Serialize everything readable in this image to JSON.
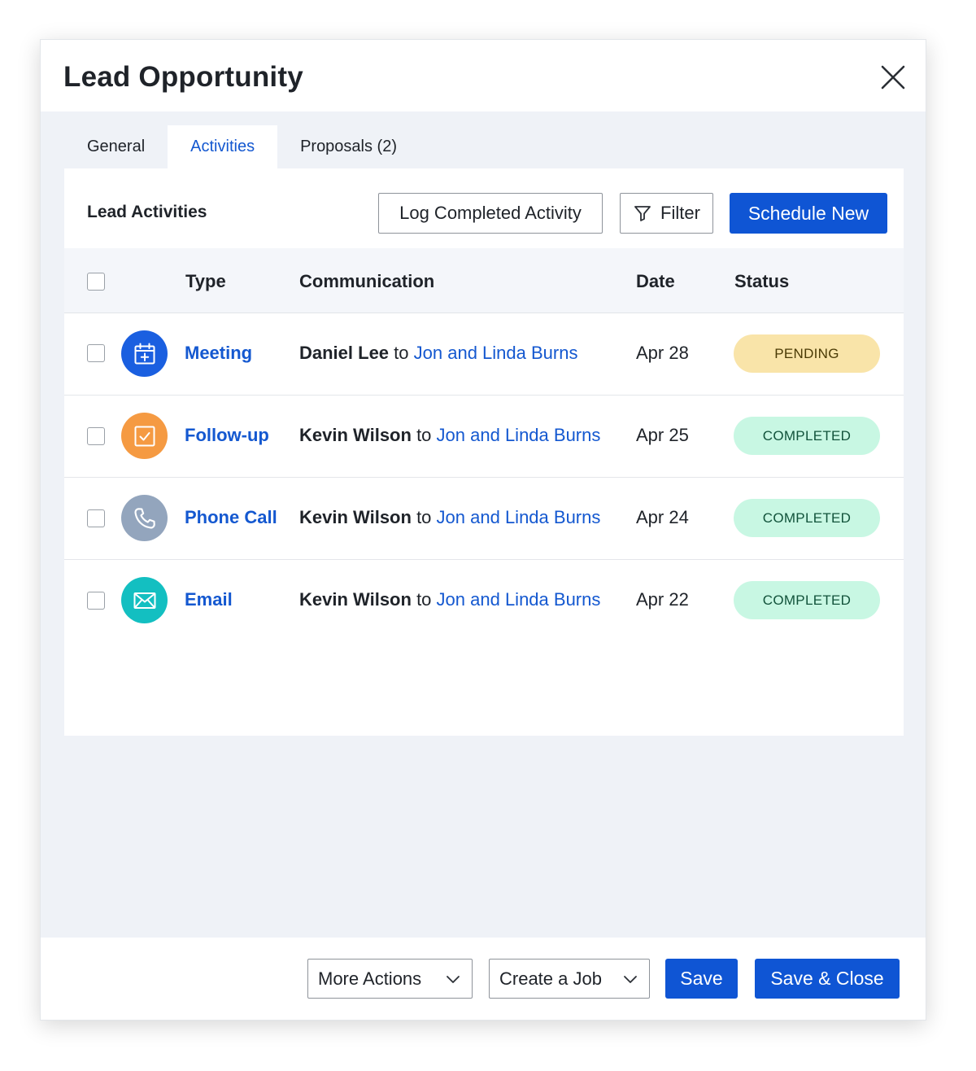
{
  "dialog": {
    "title": "Lead Opportunity"
  },
  "tabs": [
    {
      "label": "General",
      "active": false
    },
    {
      "label": "Activities",
      "active": true
    },
    {
      "label": "Proposals (2)",
      "active": false
    }
  ],
  "activities": {
    "title": "Lead Activities",
    "log_completed_label": "Log Completed Activity",
    "filter_label": "Filter",
    "schedule_new_label": "Schedule New",
    "columns": {
      "type": "Type",
      "communication": "Communication",
      "date": "Date",
      "status": "Status"
    },
    "rows": [
      {
        "type": "Meeting",
        "icon": "calendar-icon",
        "icon_color": "#1a5fe0",
        "from": "Daniel Lee",
        "connector": "to",
        "to": "Jon and Linda Burns",
        "date": "Apr 28",
        "status": "PENDING",
        "status_bg": "#f9e4a9",
        "status_fg": "#4a3a05"
      },
      {
        "type": "Follow-up",
        "icon": "checkbox-task-icon",
        "icon_color": "#f59a42",
        "from": "Kevin Wilson",
        "connector": "to",
        "to": "Jon and Linda Burns",
        "date": "Apr 25",
        "status": "COMPLETED",
        "status_bg": "#c8f7e3",
        "status_fg": "#12533b"
      },
      {
        "type": "Phone Call",
        "icon": "phone-icon",
        "icon_color": "#93a5bd",
        "from": "Kevin Wilson",
        "connector": "to",
        "to": "Jon and Linda Burns",
        "date": "Apr 24",
        "status": "COMPLETED",
        "status_bg": "#c8f7e3",
        "status_fg": "#12533b"
      },
      {
        "type": "Email",
        "icon": "envelope-icon",
        "icon_color": "#13bfc1",
        "from": "Kevin Wilson",
        "connector": "to",
        "to": "Jon and Linda Burns",
        "date": "Apr 22",
        "status": "COMPLETED",
        "status_bg": "#c8f7e3",
        "status_fg": "#12533b"
      }
    ]
  },
  "footer": {
    "more_actions_label": "More Actions",
    "create_job_label": "Create a Job",
    "save_label": "Save",
    "save_close_label": "Save & Close"
  },
  "colors": {
    "primary": "#0f55d4",
    "link": "#1458d0",
    "surface": "#eff2f7"
  }
}
